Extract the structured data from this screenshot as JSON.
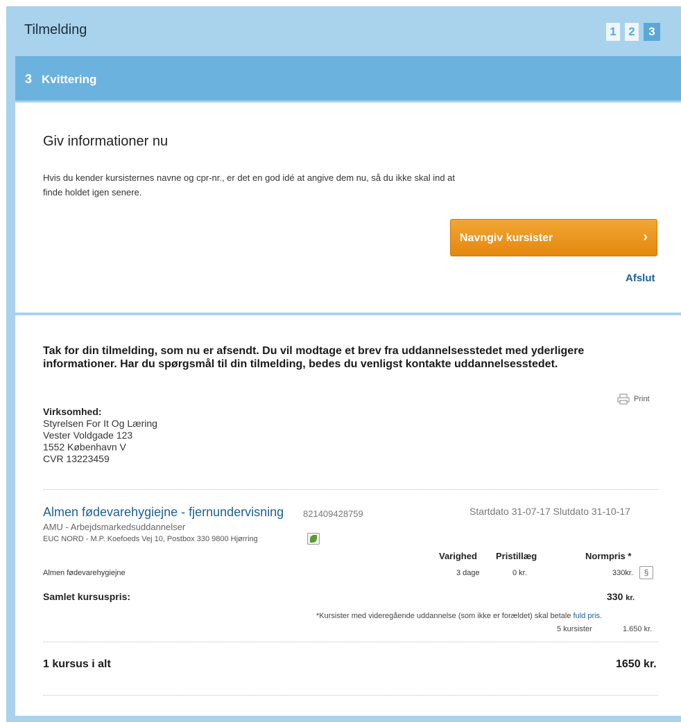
{
  "header": {
    "title": "Tilmelding",
    "steps": [
      "1",
      "2",
      "3"
    ]
  },
  "section": {
    "number": "3",
    "title": "Kvittering"
  },
  "info_panel": {
    "heading": "Giv informationer nu",
    "text": "Hvis du kender kursisternes navne og cpr-nr., er det en god idé at angive dem nu, så du ikke skal ind at finde holdet igen senere.",
    "cta_label": "Navngiv kursister",
    "finish_link": "Afslut"
  },
  "receipt": {
    "thanks": "Tak for din tilmelding, som nu er afsendt. Du vil modtage et brev fra uddannelsesstedet med yderligere informationer. Har du spørgsmål til din tilmelding, bedes du venligst kontakte uddannelsesstedet.",
    "print_label": "Print",
    "company": {
      "label": "Virksomhed:",
      "name": "Styrelsen For It Og Læring",
      "street": "Vester Voldgade 123",
      "city": "1552 København V",
      "cvr": "CVR 13223459"
    },
    "course": {
      "title": "Almen fødevarehygiejne - fjernundervisning",
      "code": "821409428759",
      "dates": "Startdato  31-07-17  Slutdato  31-10-17",
      "amu": "AMU - Arbejdsmarkedsuddannelser",
      "address": "EUC NORD - M.P. Koefoeds Vej 10, Postbox 330 9800 Hjørring",
      "columns": {
        "duration": "Varighed",
        "surcharge": "Pristillæg",
        "price": "Normpris *"
      },
      "row": {
        "name": "Almen fødevarehygiejne",
        "duration": "3 dage",
        "surcharge": "0 kr.",
        "price": "330kr."
      },
      "total_label": "Samlet kursuspris:",
      "total_value": "330",
      "total_unit": "kr.",
      "note": "*Kursister med videregående uddannelse (som ikke er forældet) skal betale ",
      "note_link": "fuld pris.",
      "participants": "5 kursister",
      "participants_price": "1.650 kr."
    },
    "summary": {
      "label": "1 kursus i alt",
      "value": "1650 kr."
    }
  }
}
